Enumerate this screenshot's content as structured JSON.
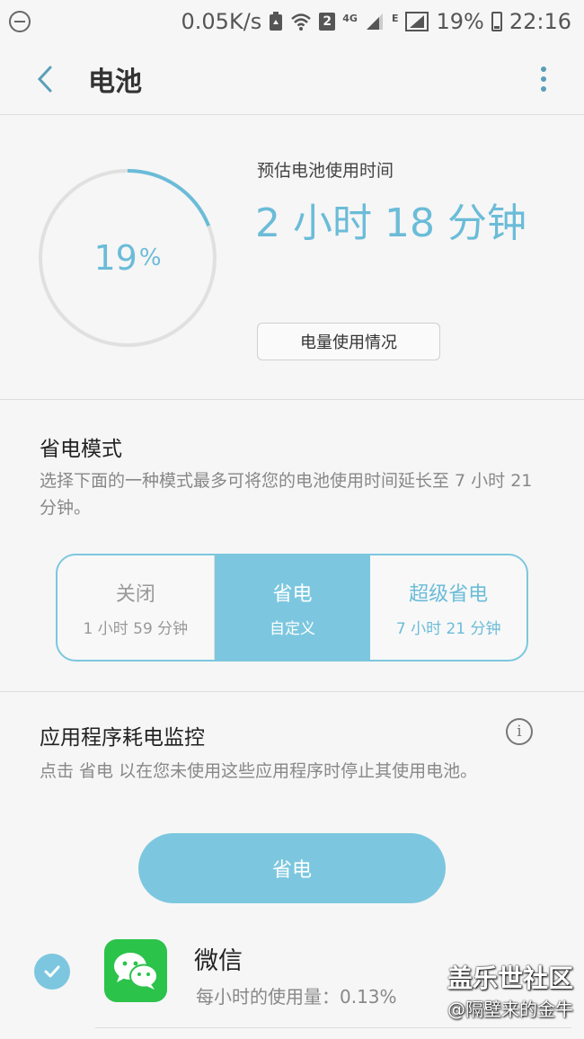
{
  "status_bar": {
    "speed": "0.05K/s",
    "sim": "2",
    "net_4g": "4G",
    "net_e": "E",
    "battery": "19%",
    "time": "22:16"
  },
  "app_bar": {
    "title": "电池"
  },
  "battery": {
    "level_percent": 19,
    "level_number": "19",
    "level_unit": "%",
    "estimate_label": "预估电池使用时间",
    "estimate_value": "2 小时 18 分钟",
    "usage_button": "电量使用情况",
    "gauge_color": "#6bbcd8",
    "track_color": "#e0e0e0"
  },
  "power_saving": {
    "title": "省电模式",
    "description": "选择下面的一种模式最多可将您的电池使用时间延长至 7 小时 21 分钟。",
    "modes": [
      {
        "name": "关闭",
        "sub": "1 小时 59 分钟"
      },
      {
        "name": "省电",
        "sub": "自定义"
      },
      {
        "name": "超级省电",
        "sub": "7 小时 21 分钟"
      }
    ],
    "selected_mode": "省电"
  },
  "app_monitor": {
    "title": "应用程序耗电监控",
    "info_glyph": "i",
    "description": "点击 省电 以在您未使用这些应用程序时停止其使用电池。",
    "save_button": "省电",
    "apps": [
      {
        "name": "微信",
        "usage": "每小时的使用量：0.13%",
        "checked": true,
        "icon": "wechat-icon"
      }
    ]
  },
  "watermark": {
    "line1": "盖乐世社区",
    "line2": "@隔壁来的金牛"
  },
  "colors": {
    "accent": "#7cc7df",
    "accent_text": "#6bbcd8",
    "wechat_green": "#2bc34a"
  }
}
